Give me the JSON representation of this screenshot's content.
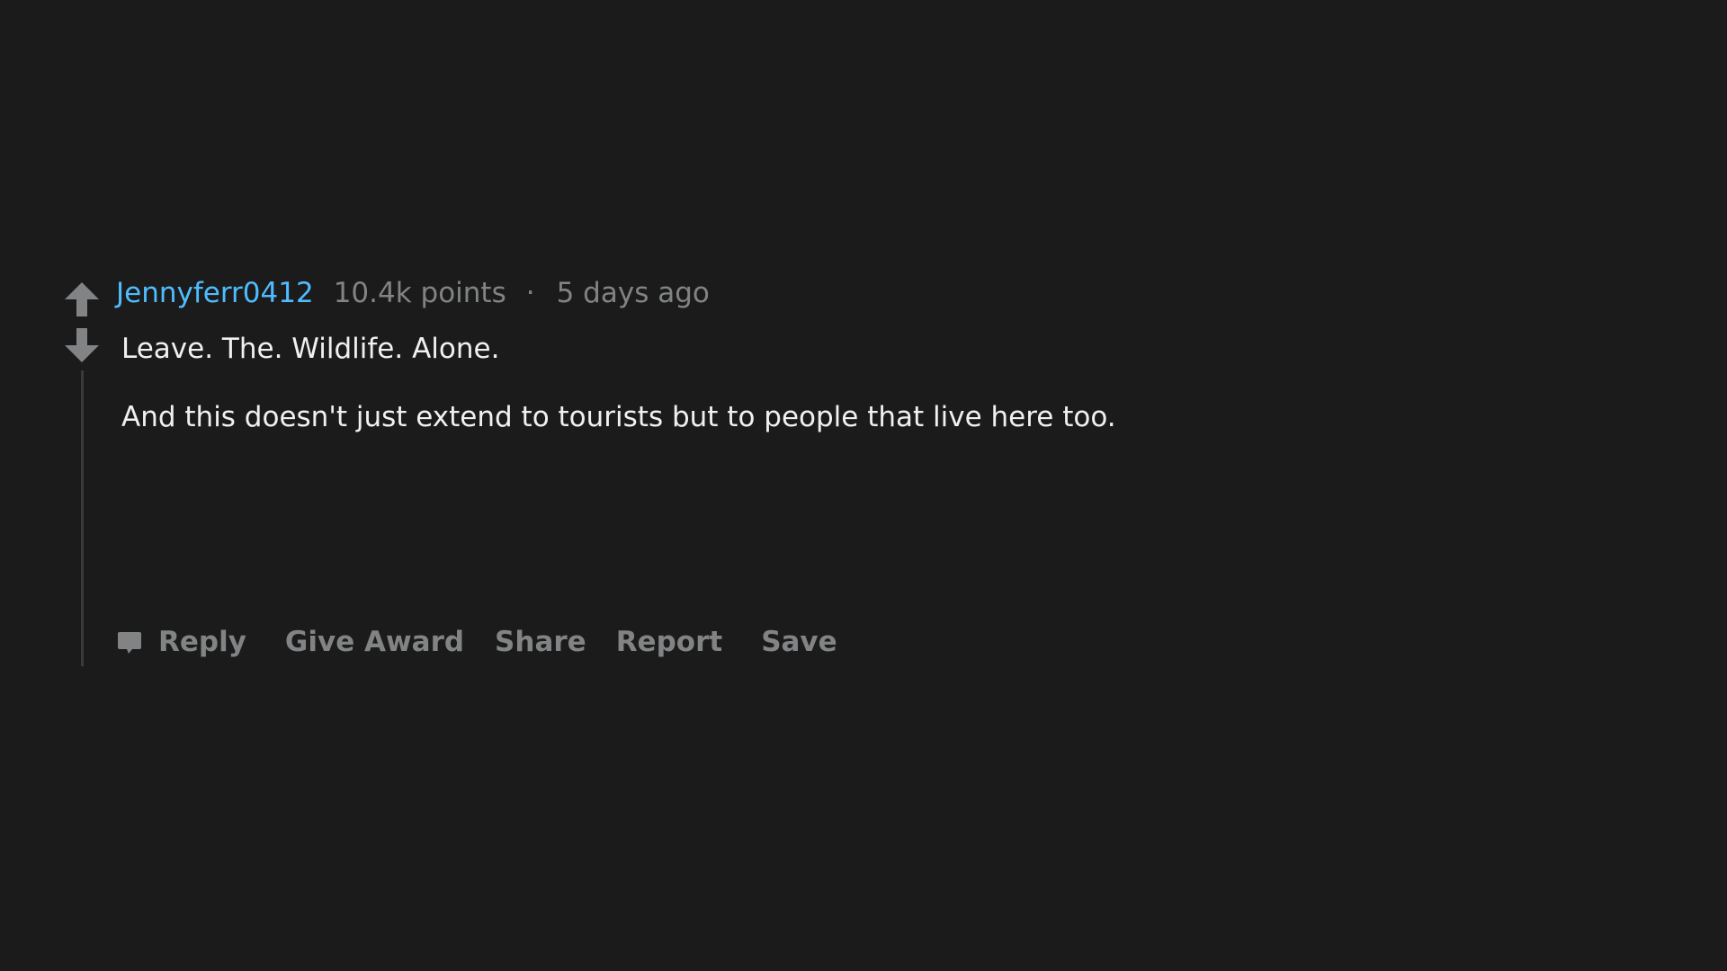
{
  "comment": {
    "author": "Jennyferr0412",
    "points": "10.4k points",
    "separator": "·",
    "time": "5 days ago",
    "body": [
      "Leave. The. Wildlife. Alone.",
      "And this doesn't just extend to tourists but to people that live here too."
    ],
    "actions": {
      "reply": "Reply",
      "give_award": "Give Award",
      "share": "Share",
      "report": "Report",
      "save": "Save"
    }
  },
  "icons": {
    "upvote": "arrow-up-icon",
    "downvote": "arrow-down-icon",
    "reply": "comment-bubble-icon"
  },
  "colors": {
    "background": "#1b1b1b",
    "author": "#4fbcff",
    "meta": "#818384",
    "body_text": "#f0f0f0",
    "thread_line": "#3a3a3a"
  }
}
